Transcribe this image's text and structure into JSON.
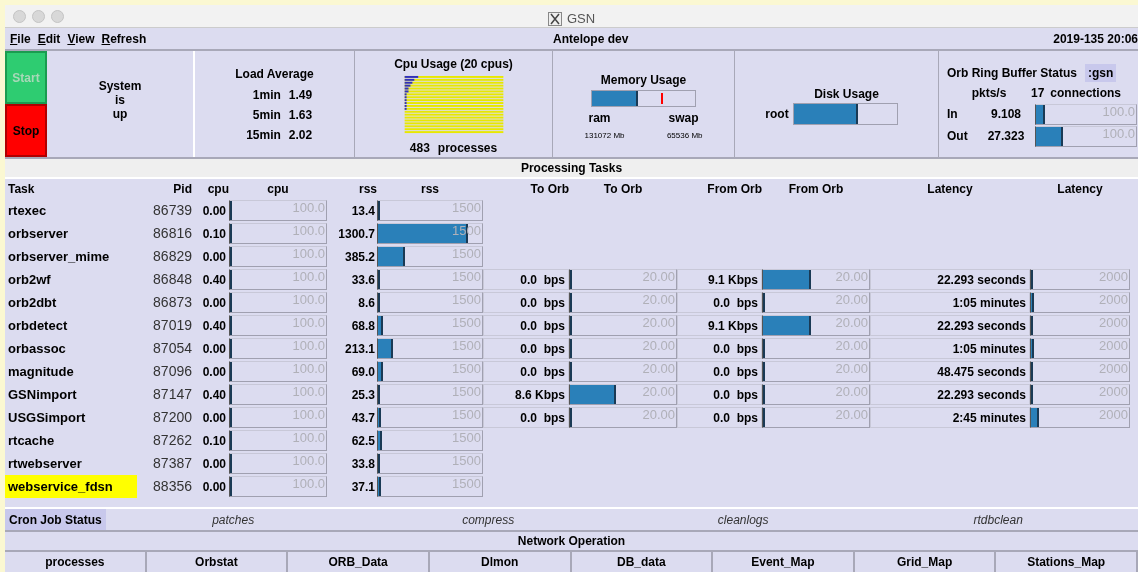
{
  "window": {
    "title": "GSN"
  },
  "menu": [
    "File",
    "Edit",
    "View",
    "Refresh"
  ],
  "header": {
    "center": "Antelope dev",
    "right": "2019-135 20:06"
  },
  "controls": {
    "start": {
      "label": "Start",
      "disabled": true
    },
    "stop": {
      "label": "Stop",
      "disabled": false
    }
  },
  "system_status": [
    "System",
    "is",
    "up"
  ],
  "load_average": {
    "title": "Load Average",
    "rows": [
      {
        "label": "1min",
        "value": "1.49"
      },
      {
        "label": "5min",
        "value": "1.63"
      },
      {
        "label": "15min",
        "value": "2.02"
      }
    ]
  },
  "cpu_usage": {
    "title": "Cpu Usage (20 cpus)",
    "processes": "483",
    "processes_label": "processes"
  },
  "memory": {
    "title": "Memory Usage",
    "ram": {
      "label": "ram",
      "size": "131072 Mb",
      "level": 0.45
    },
    "swap": {
      "label": "swap",
      "size": "65536 Mb",
      "level": 0.67
    }
  },
  "disk": {
    "title": "Disk Usage",
    "volumes": [
      {
        "name": "root",
        "level": 0.62
      }
    ]
  },
  "orb": {
    "title": "Orb Ring Buffer Status",
    "name": ":gsn",
    "rate_label": "pkts/s",
    "connections": "17",
    "connections_label": "connections",
    "rows": [
      {
        "label": "In",
        "value": "9.108",
        "level": 0.09,
        "scale": "100.0"
      },
      {
        "label": "Out",
        "value": "27.323",
        "level": 0.27,
        "scale": "100.0"
      }
    ]
  },
  "processing": {
    "title": "Processing Tasks",
    "columns": [
      "Task",
      "Pid",
      "cpu",
      "cpu",
      "rss",
      "rss",
      "To Orb",
      "To Orb",
      "From Orb",
      "From Orb",
      "Latency",
      "Latency"
    ],
    "rows": [
      {
        "task": "rtexec",
        "highlighted": false,
        "pid": "86739",
        "cpu": {
          "reading": "0.00",
          "level": 0,
          "scale": "100.0"
        },
        "rss": {
          "reading": "13.4",
          "level": 0.009,
          "scale": "1500"
        }
      },
      {
        "task": "orbserver",
        "highlighted": false,
        "pid": "86816",
        "cpu": {
          "reading": "0.10",
          "level": 0.001,
          "scale": "100.0"
        },
        "rss": {
          "reading": "1300.7",
          "level": 0.867,
          "scale": "1500"
        }
      },
      {
        "task": "orbserver_mime",
        "highlighted": false,
        "pid": "86829",
        "cpu": {
          "reading": "0.00",
          "level": 0,
          "scale": "100.0"
        },
        "rss": {
          "reading": "385.2",
          "level": 0.257,
          "scale": "1500"
        }
      },
      {
        "task": "orb2wf",
        "highlighted": false,
        "pid": "86848",
        "cpu": {
          "reading": "0.40",
          "level": 0.004,
          "scale": "100.0"
        },
        "rss": {
          "reading": "33.6",
          "level": 0.022,
          "scale": "1500"
        },
        "to_orb": {
          "reading": "0.0  bps",
          "level": 0,
          "scale": "20.00"
        },
        "from_orb": {
          "reading": "9.1 Kbps",
          "level": 0.45,
          "scale": "20.00"
        },
        "latency": {
          "reading": "22.293 seconds",
          "level": 0.011,
          "scale": "2000"
        }
      },
      {
        "task": "orb2dbt",
        "highlighted": false,
        "pid": "86873",
        "cpu": {
          "reading": "0.00",
          "level": 0,
          "scale": "100.0"
        },
        "rss": {
          "reading": "8.6",
          "level": 0.006,
          "scale": "1500"
        },
        "to_orb": {
          "reading": "0.0  bps",
          "level": 0,
          "scale": "20.00"
        },
        "from_orb": {
          "reading": "0.0  bps",
          "level": 0,
          "scale": "20.00"
        },
        "latency": {
          "reading": "1:05 minutes",
          "level": 0.03,
          "scale": "2000"
        }
      },
      {
        "task": "orbdetect",
        "highlighted": false,
        "pid": "87019",
        "cpu": {
          "reading": "0.40",
          "level": 0.004,
          "scale": "100.0"
        },
        "rss": {
          "reading": "68.8",
          "level": 0.046,
          "scale": "1500"
        },
        "to_orb": {
          "reading": "0.0  bps",
          "level": 0,
          "scale": "20.00"
        },
        "from_orb": {
          "reading": "9.1 Kbps",
          "level": 0.45,
          "scale": "20.00"
        },
        "latency": {
          "reading": "22.293 seconds",
          "level": 0.011,
          "scale": "2000"
        }
      },
      {
        "task": "orbassoc",
        "highlighted": false,
        "pid": "87054",
        "cpu": {
          "reading": "0.00",
          "level": 0,
          "scale": "100.0"
        },
        "rss": {
          "reading": "213.1",
          "level": 0.142,
          "scale": "1500"
        },
        "to_orb": {
          "reading": "0.0  bps",
          "level": 0,
          "scale": "20.00"
        },
        "from_orb": {
          "reading": "0.0  bps",
          "level": 0,
          "scale": "20.00"
        },
        "latency": {
          "reading": "1:05 minutes",
          "level": 0.03,
          "scale": "2000"
        }
      },
      {
        "task": "magnitude",
        "highlighted": false,
        "pid": "87096",
        "cpu": {
          "reading": "0.00",
          "level": 0,
          "scale": "100.0"
        },
        "rss": {
          "reading": "69.0",
          "level": 0.046,
          "scale": "1500"
        },
        "to_orb": {
          "reading": "0.0  bps",
          "level": 0,
          "scale": "20.00"
        },
        "from_orb": {
          "reading": "0.0  bps",
          "level": 0,
          "scale": "20.00"
        },
        "latency": {
          "reading": "48.475 seconds",
          "level": 0.024,
          "scale": "2000"
        }
      },
      {
        "task": "GSNimport",
        "highlighted": false,
        "pid": "87147",
        "cpu": {
          "reading": "0.40",
          "level": 0.004,
          "scale": "100.0"
        },
        "rss": {
          "reading": "25.3",
          "level": 0.017,
          "scale": "1500"
        },
        "to_orb": {
          "reading": "8.6 Kbps",
          "level": 0.43,
          "scale": "20.00"
        },
        "from_orb": {
          "reading": "0.0  bps",
          "level": 0,
          "scale": "20.00"
        },
        "latency": {
          "reading": "22.293 seconds",
          "level": 0.011,
          "scale": "2000"
        }
      },
      {
        "task": "USGSimport",
        "highlighted": false,
        "pid": "87200",
        "cpu": {
          "reading": "0.00",
          "level": 0,
          "scale": "100.0"
        },
        "rss": {
          "reading": "43.7",
          "level": 0.029,
          "scale": "1500"
        },
        "to_orb": {
          "reading": "0.0  bps",
          "level": 0,
          "scale": "20.00"
        },
        "from_orb": {
          "reading": "0.0  bps",
          "level": 0,
          "scale": "20.00"
        },
        "latency": {
          "reading": "2:45 minutes",
          "level": 0.08,
          "scale": "2000"
        }
      },
      {
        "task": "rtcache",
        "highlighted": false,
        "pid": "87262",
        "cpu": {
          "reading": "0.10",
          "level": 0.001,
          "scale": "100.0"
        },
        "rss": {
          "reading": "62.5",
          "level": 0.042,
          "scale": "1500"
        }
      },
      {
        "task": "rtwebserver",
        "highlighted": false,
        "pid": "87387",
        "cpu": {
          "reading": "0.00",
          "level": 0,
          "scale": "100.0"
        },
        "rss": {
          "reading": "33.8",
          "level": 0.023,
          "scale": "1500"
        }
      },
      {
        "task": "webservice_fdsn",
        "highlighted": true,
        "pid": "88356",
        "cpu": {
          "reading": "0.00",
          "level": 0,
          "scale": "100.0"
        },
        "rss": {
          "reading": "37.1",
          "level": 0.025,
          "scale": "1500"
        }
      }
    ]
  },
  "cron": {
    "title": "Cron Job Status",
    "jobs": [
      "patches",
      "compress",
      "cleanlogs",
      "rtdbclean"
    ]
  },
  "network": {
    "title": "Network Operation",
    "buttons": [
      "processes",
      "Orbstat",
      "ORB_Data",
      "Dlmon",
      "DB_data",
      "Event_Map",
      "Grid_Map",
      "Stations_Map"
    ]
  }
}
